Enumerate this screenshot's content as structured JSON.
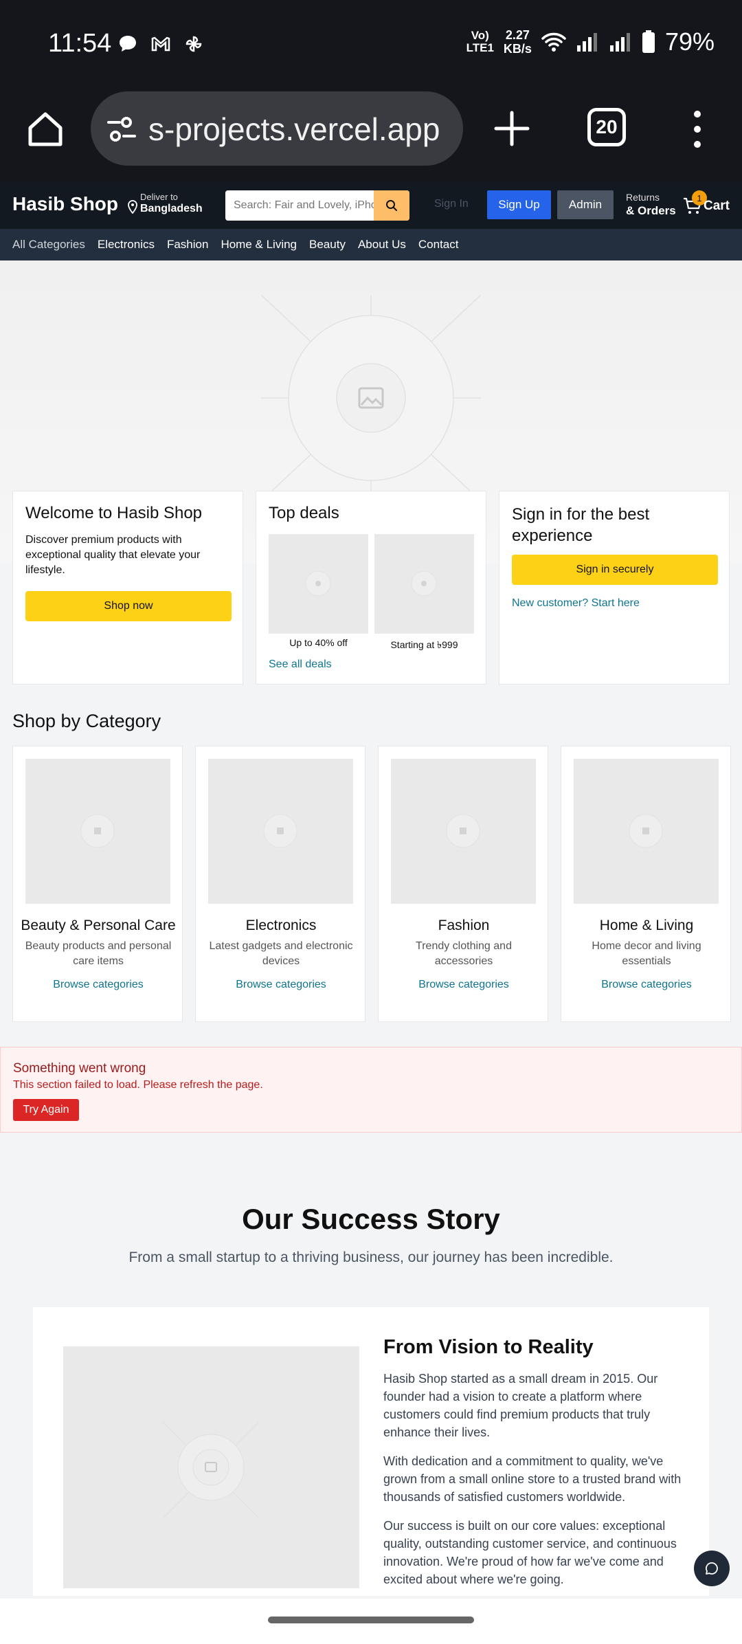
{
  "status_bar": {
    "time": "11:54",
    "network_top": "Vo)",
    "network_bottom": "LTE1",
    "speed_top": "2.27",
    "speed_bottom": "KB/s",
    "battery": "79%"
  },
  "browser": {
    "url": "s-projects.vercel.app",
    "tab_count": "20"
  },
  "header": {
    "logo": "Hasib Shop",
    "deliver_to_label": "Deliver to",
    "deliver_to_location": "Bangladesh",
    "search_placeholder": "Search: Fair and Lovely, iPhone",
    "sign_in": "Sign In",
    "sign_up": "Sign Up",
    "admin": "Admin",
    "returns_label": "Returns",
    "orders_label": "& Orders",
    "cart_label": "Cart",
    "cart_count": "1"
  },
  "category_nav": [
    "All Categories",
    "Electronics",
    "Fashion",
    "Home & Living",
    "Beauty",
    "About Us",
    "Contact"
  ],
  "cards": {
    "welcome": {
      "title": "Welcome to Hasib Shop",
      "text": "Discover premium products with exceptional quality that elevate your lifestyle.",
      "button": "Shop now"
    },
    "deals": {
      "title": "Top deals",
      "deal1_caption": "Up to 40% off",
      "deal2_caption": "Starting at ৳999",
      "link": "See all deals"
    },
    "signin": {
      "title": "Sign in for the best experience",
      "button": "Sign in securely",
      "link": "New customer? Start here"
    }
  },
  "shop_by_category": {
    "title": "Shop by Category",
    "items": [
      {
        "name": "Beauty & Personal Care",
        "desc": "Beauty products and personal care items",
        "link": "Browse categories"
      },
      {
        "name": "Electronics",
        "desc": "Latest gadgets and electronic devices",
        "link": "Browse categories"
      },
      {
        "name": "Fashion",
        "desc": "Trendy clothing and accessories",
        "link": "Browse categories"
      },
      {
        "name": "Home & Living",
        "desc": "Home decor and living essentials",
        "link": "Browse categories"
      }
    ]
  },
  "error": {
    "title": "Something went wrong",
    "message": "This section failed to load. Please refresh the page.",
    "button": "Try Again"
  },
  "success_story": {
    "title": "Our Success Story",
    "subtitle": "From a small startup to a thriving business, our journey has been incredible.",
    "heading": "From Vision to Reality",
    "paragraphs": [
      "Hasib Shop started as a small dream in 2015. Our founder had a vision to create a platform where customers could find premium products that truly enhance their lives.",
      "With dedication and a commitment to quality, we've grown from a small online store to a trusted brand with thousands of satisfied customers worldwide.",
      "Our success is built on our core values: exceptional quality, outstanding customer service, and continuous innovation. We're proud of how far we've come and excited about where we're going."
    ]
  },
  "colors": {
    "header_bg": "#131921",
    "nav_bg": "#232f3e",
    "accent_yellow": "#fcd116",
    "search_button": "#febd69",
    "signup_blue": "#2563eb",
    "link_teal": "#0e7490",
    "error_red": "#dc2626"
  }
}
